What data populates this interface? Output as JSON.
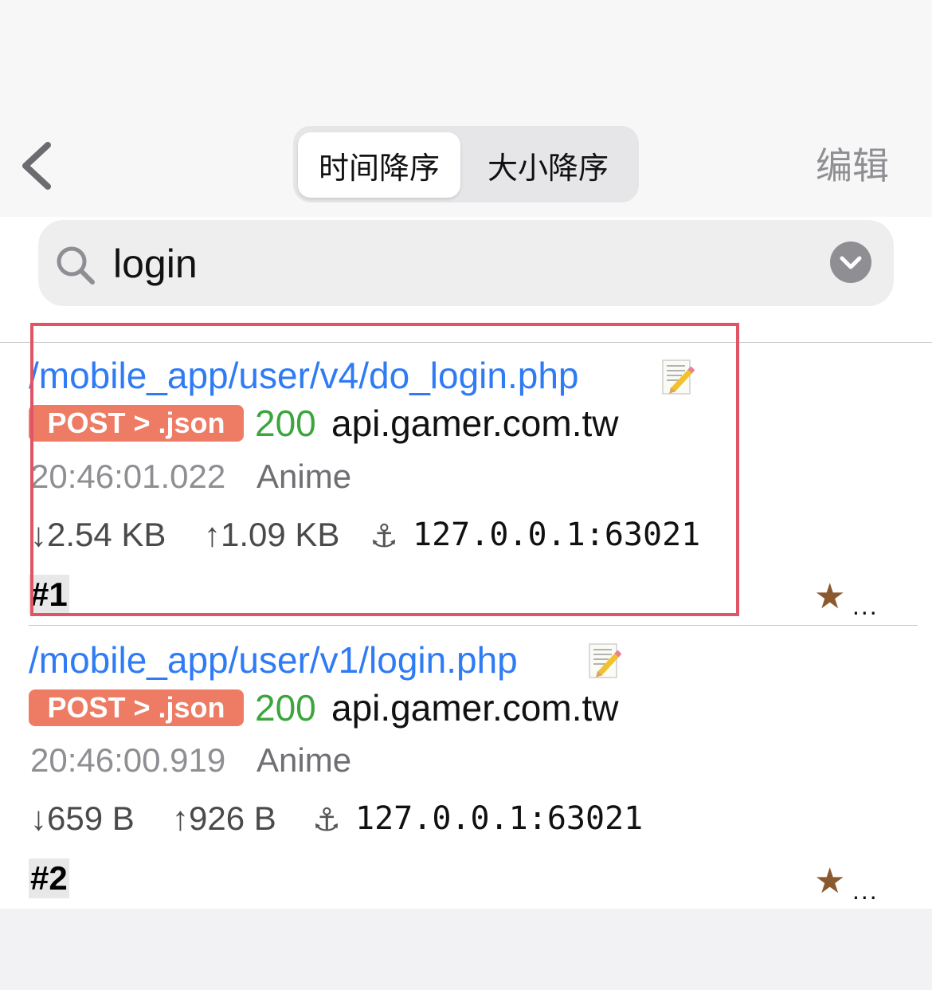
{
  "nav": {
    "back_icon": "chevron-left-icon",
    "segments": [
      {
        "label": "时间降序",
        "selected": true
      },
      {
        "label": "大小降序",
        "selected": false
      }
    ],
    "edit_label": "编辑"
  },
  "search": {
    "icon": "search-icon",
    "value": "login",
    "dropdown_icon": "chevron-down-icon"
  },
  "requests": [
    {
      "path": "/mobile_app/user/v4/do_login.php",
      "method": "POST > .json",
      "status": "200",
      "host": "api.gamer.com.tw",
      "time": "20:46:01.022",
      "app": "Anime",
      "download": "↓2.54 KB",
      "upload": "↑1.09 KB",
      "anchor": "⚓",
      "address": "127.0.0.1:63021",
      "index": "#1",
      "star": "★",
      "more": "...",
      "highlighted": true
    },
    {
      "path": "/mobile_app/user/v1/login.php",
      "method": "POST > .json",
      "status": "200",
      "host": "api.gamer.com.tw",
      "time": "20:46:00.919",
      "app": "Anime",
      "download": "↓659 B",
      "upload": "↑926 B",
      "anchor": "⚓",
      "address": "127.0.0.1:63021",
      "index": "#2",
      "star": "★",
      "more": "...",
      "highlighted": false
    }
  ],
  "colors": {
    "link": "#2f7bf5",
    "method_badge": "#ee7c64",
    "status_ok": "#3ca63e",
    "highlight_border": "#e05566",
    "star": "#8a5a2e"
  }
}
